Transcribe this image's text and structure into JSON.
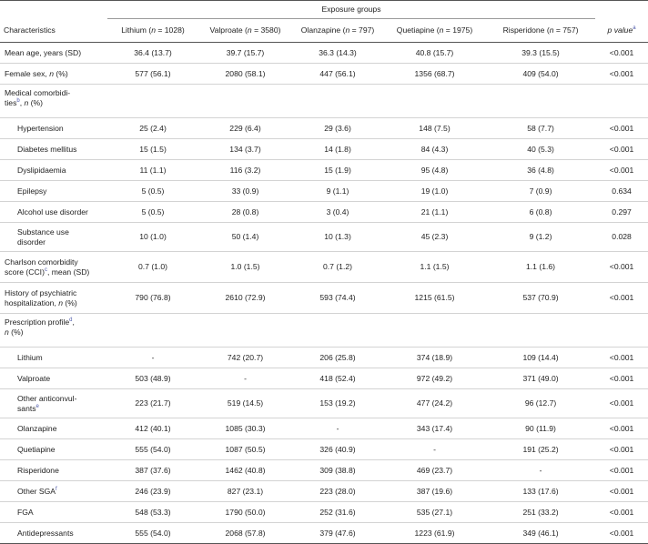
{
  "header": {
    "group_label": "Exposure groups",
    "characteristics": "Characteristics",
    "p_value": "p value",
    "p_value_sup": "a",
    "columns": [
      {
        "name": "Lithium",
        "n_label": "n",
        "n_value": "= 1028)"
      },
      {
        "name": "Valproate",
        "n_label": "n",
        "n_value": "= 3580)"
      },
      {
        "name": "Olanzapine",
        "n_label": "n",
        "n_value": "= 797)"
      },
      {
        "name": "Quetiapine",
        "n_label": "n",
        "n_value": "= 1975)"
      },
      {
        "name": "Risperidone",
        "n_label": "n",
        "n_value": "= 757)"
      }
    ]
  },
  "rows": {
    "mean_age": {
      "label": "Mean age, years (SD)",
      "values": [
        "36.4 (13.7)",
        "39.7 (15.7)",
        "36.3 (14.3)",
        "40.8 (15.7)",
        "39.3 (15.5)"
      ],
      "p": "<0.001"
    },
    "female": {
      "label_a": "Female sex, ",
      "label_n": "n",
      "label_b": " (%)",
      "values": [
        "577 (56.1)",
        "2080 (58.1)",
        "447 (56.1)",
        "1356 (68.7)",
        "409 (54.0)"
      ],
      "p": "<0.001"
    },
    "medical_comorbidities": {
      "label_a": "Medical comorbidi-",
      "label_b": "ties",
      "sup": "b",
      "label_c": ", ",
      "label_n": "n",
      "label_d": " (%)"
    },
    "hypertension": {
      "label": "Hypertension",
      "values": [
        "25 (2.4)",
        "229 (6.4)",
        "29 (3.6)",
        "148 (7.5)",
        "58 (7.7)"
      ],
      "p": "<0.001"
    },
    "diabetes": {
      "label": "Diabetes mellitus",
      "values": [
        "15 (1.5)",
        "134 (3.7)",
        "14 (1.8)",
        "84 (4.3)",
        "40 (5.3)"
      ],
      "p": "<0.001"
    },
    "dyslipidaemia": {
      "label": "Dyslipidaemia",
      "values": [
        "11 (1.1)",
        "116 (3.2)",
        "15 (1.9)",
        "95 (4.8)",
        "36 (4.8)"
      ],
      "p": "<0.001"
    },
    "epilepsy": {
      "label": "Epilepsy",
      "values": [
        "5 (0.5)",
        "33 (0.9)",
        "9 (1.1)",
        "19 (1.0)",
        "7 (0.9)"
      ],
      "p": "0.634"
    },
    "alcohol": {
      "label": "Alcohol use disorder",
      "values": [
        "5 (0.5)",
        "28 (0.8)",
        "3 (0.4)",
        "21 (1.1)",
        "6 (0.8)"
      ],
      "p": "0.297"
    },
    "substance": {
      "label_a": "Substance use",
      "label_b": "disorder",
      "values": [
        "10 (1.0)",
        "50 (1.4)",
        "10 (1.3)",
        "45 (2.3)",
        "9 (1.2)"
      ],
      "p": "0.028"
    },
    "charlson": {
      "label_a": "Charlson comorbidity",
      "label_b": "score (CCI)",
      "sup": "c",
      "label_c": ", mean (SD)",
      "values": [
        "0.7 (1.0)",
        "1.0 (1.5)",
        "0.7 (1.2)",
        "1.1 (1.5)",
        "1.1 (1.6)"
      ],
      "p": "<0.001"
    },
    "psych_hosp": {
      "label_a": "History of psychiatric",
      "label_b": "hospitalization, ",
      "label_n": "n",
      "label_c": " (%)",
      "values": [
        "790 (76.8)",
        "2610 (72.9)",
        "593 (74.4)",
        "1215 (61.5)",
        "537 (70.9)"
      ],
      "p": "<0.001"
    },
    "prescription_profile": {
      "label_a": "Prescription profile",
      "sup": "d",
      "label_b": ",",
      "label_n": "n",
      "label_c": " (%)"
    },
    "lithium": {
      "label": "Lithium",
      "values": [
        "-",
        "742 (20.7)",
        "206 (25.8)",
        "374 (18.9)",
        "109 (14.4)"
      ],
      "p": "<0.001"
    },
    "valproate": {
      "label": "Valproate",
      "values": [
        "503 (48.9)",
        "-",
        "418 (52.4)",
        "972 (49.2)",
        "371 (49.0)"
      ],
      "p": "<0.001"
    },
    "anticonvulsants": {
      "label_a": "Other anticonvul-",
      "label_b": "sants",
      "sup": "e",
      "values": [
        "223 (21.7)",
        "519 (14.5)",
        "153 (19.2)",
        "477 (24.2)",
        "96 (12.7)"
      ],
      "p": "<0.001"
    },
    "olanzapine": {
      "label": "Olanzapine",
      "values": [
        "412 (40.1)",
        "1085 (30.3)",
        "-",
        "343 (17.4)",
        "90 (11.9)"
      ],
      "p": "<0.001"
    },
    "quetiapine": {
      "label": "Quetiapine",
      "values": [
        "555 (54.0)",
        "1087 (50.5)",
        "326 (40.9)",
        "-",
        "191 (25.2)"
      ],
      "p": "<0.001"
    },
    "risperidone": {
      "label": "Risperidone",
      "values": [
        "387 (37.6)",
        "1462 (40.8)",
        "309 (38.8)",
        "469 (23.7)",
        "-"
      ],
      "p": "<0.001"
    },
    "other_sga": {
      "label": "Other SGA",
      "sup": "f",
      "values": [
        "246 (23.9)",
        "827 (23.1)",
        "223 (28.0)",
        "387 (19.6)",
        "133 (17.6)"
      ],
      "p": "<0.001"
    },
    "fga": {
      "label": "FGA",
      "values": [
        "548 (53.3)",
        "1790 (50.0)",
        "252 (31.6)",
        "535 (27.1)",
        "251 (33.2)"
      ],
      "p": "<0.001"
    },
    "antidepressants": {
      "label": "Antidepressants",
      "values": [
        "555 (54.0)",
        "2068 (57.8)",
        "379 (47.6)",
        "1223 (61.9)",
        "349 (46.1)"
      ],
      "p": "<0.001"
    }
  },
  "colors": {
    "footnote_sup": "#4a56a8",
    "rule": "#555555",
    "row_rule": "#d3d3d3"
  }
}
